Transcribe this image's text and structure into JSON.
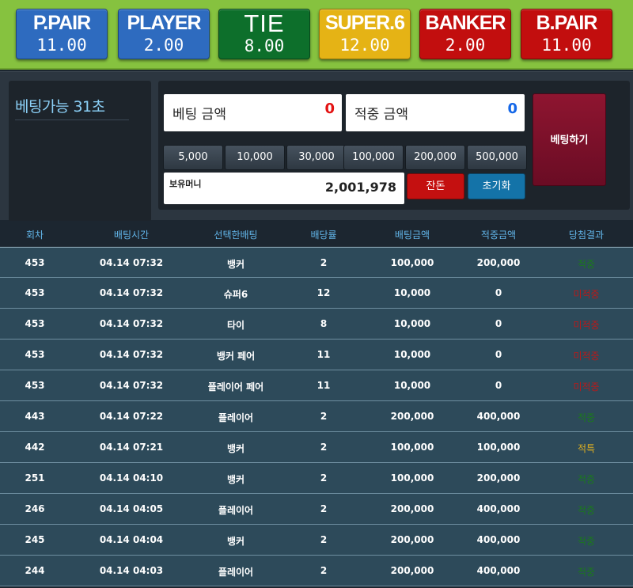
{
  "bets": [
    {
      "name": "P.PAIR",
      "odds": "11.00",
      "color": "#2e6bbf"
    },
    {
      "name": "PLAYER",
      "odds": "2.00",
      "color": "#2e6bbf"
    },
    {
      "name": "TIE",
      "odds": "8.00",
      "color": "#0d6f2b"
    },
    {
      "name": "SUPER.6",
      "odds": "12.00",
      "color": "#e5b315"
    },
    {
      "name": "BANKER",
      "odds": "2.00",
      "color": "#c20e0e"
    },
    {
      "name": "B.PAIR",
      "odds": "11.00",
      "color": "#c20e0e"
    }
  ],
  "timer": "베팅가능 31초",
  "bet_amount": {
    "label": "베팅 금액",
    "value": "0",
    "value_color": "#e31212"
  },
  "win_amount": {
    "label": "적중 금액",
    "value": "0",
    "value_color": "#1467e8"
  },
  "chips": [
    "5,000",
    "10,000",
    "30,000",
    "100,000",
    "200,000",
    "500,000"
  ],
  "money": {
    "label": "보유머니",
    "value": "2,001,978"
  },
  "buttons": {
    "allin": "잔돈",
    "reset": "초기화",
    "place": "베팅하기"
  },
  "table": {
    "headers": [
      "회차",
      "배팅시간",
      "선택한배팅",
      "배당률",
      "배팅금액",
      "적중금액",
      "당첨결과"
    ],
    "rows": [
      [
        "453",
        "04.14 07:32",
        "뱅커",
        "2",
        "100,000",
        "200,000",
        "적중"
      ],
      [
        "453",
        "04.14 07:32",
        "슈퍼6",
        "12",
        "10,000",
        "0",
        "미적중"
      ],
      [
        "453",
        "04.14 07:32",
        "타이",
        "8",
        "10,000",
        "0",
        "미적중"
      ],
      [
        "453",
        "04.14 07:32",
        "뱅커 페어",
        "11",
        "10,000",
        "0",
        "미적중"
      ],
      [
        "453",
        "04.14 07:32",
        "플레이어 페어",
        "11",
        "10,000",
        "0",
        "미적중"
      ],
      [
        "443",
        "04.14 07:22",
        "플레이어",
        "2",
        "200,000",
        "400,000",
        "적중"
      ],
      [
        "442",
        "04.14 07:21",
        "뱅커",
        "2",
        "100,000",
        "100,000",
        "적특"
      ],
      [
        "251",
        "04.14 04:10",
        "뱅커",
        "2",
        "100,000",
        "200,000",
        "적중"
      ],
      [
        "246",
        "04.14 04:05",
        "플레이어",
        "2",
        "200,000",
        "400,000",
        "적중"
      ],
      [
        "245",
        "04.14 04:04",
        "뱅커",
        "2",
        "200,000",
        "400,000",
        "적중"
      ],
      [
        "244",
        "04.14 04:03",
        "플레이어",
        "2",
        "200,000",
        "400,000",
        "적중"
      ]
    ],
    "result_colors": {
      "적중": "#1a7a1a",
      "미적중": "#b81a1a",
      "적특": "#e0b020"
    }
  }
}
